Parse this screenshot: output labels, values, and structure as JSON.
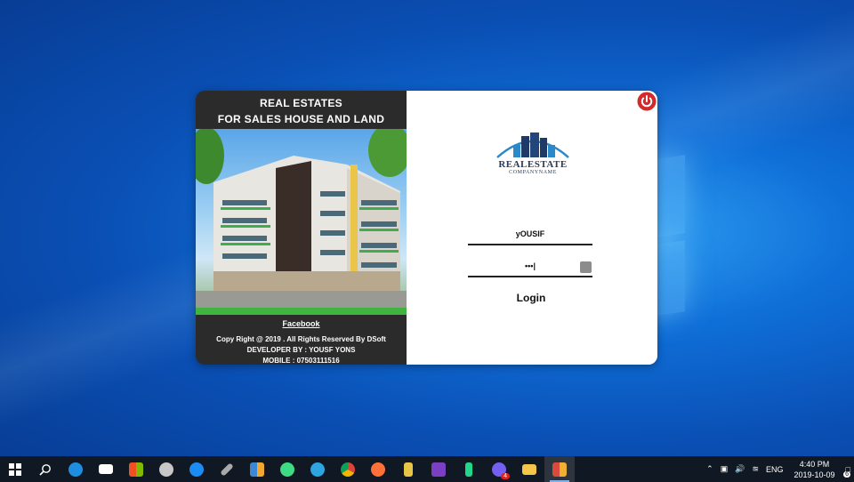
{
  "dialog": {
    "title_line1": "REAL  ESTATES",
    "title_line2": "FOR SALES HOUSE AND LAND",
    "facebook_link": "Facebook",
    "copyright": "Copy Right @ 2019 . All  Rights Reserved By DSoft",
    "developer": "DEVELOPER BY : YOUSF YONS",
    "mobile": "MOBILE : 07503111516",
    "logo_title": "REALESTATE",
    "logo_subtitle": "COMPANYNAME",
    "username_value": "yOUSIF",
    "password_value": "•••|",
    "login_label": "Login",
    "power_color": "#d32b2b"
  },
  "taskbar": {
    "icons": [
      "windows-start",
      "search",
      "edge",
      "mail",
      "store",
      "paint",
      "messenger",
      "tools",
      "folders",
      "android-studio",
      "telegram",
      "chrome",
      "firefox",
      "build-tools",
      "visual-studio",
      "pycharm",
      "viber",
      "file-explorer",
      "app-active"
    ],
    "viber_badge": "4",
    "language": "ENG",
    "time": "4:40 PM",
    "date": "2019-10-09",
    "notification_count": "6"
  }
}
